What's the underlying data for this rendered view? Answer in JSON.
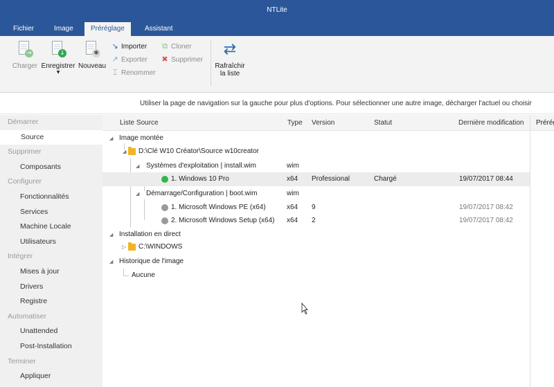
{
  "window": {
    "title": "NTLite"
  },
  "tabs": [
    {
      "label": "Fichier"
    },
    {
      "label": "Image"
    },
    {
      "label": "Préréglage",
      "active": true
    },
    {
      "label": "Assistant"
    }
  ],
  "ribbon": {
    "large_buttons": [
      {
        "label": "Charger",
        "icon": "load-preset-icon",
        "enabled": false
      },
      {
        "label": "Enregistrer",
        "icon": "save-preset-icon",
        "enabled": true,
        "dropdown": true
      },
      {
        "label": "Nouveau",
        "icon": "new-preset-icon",
        "enabled": true
      }
    ],
    "small_buttons": [
      {
        "label": "Importer",
        "icon": "import-icon",
        "enabled": true
      },
      {
        "label": "Exporter",
        "icon": "export-icon",
        "enabled": false
      },
      {
        "label": "Renommer",
        "icon": "rename-icon",
        "enabled": false
      },
      {
        "label": "Cloner",
        "icon": "clone-icon",
        "enabled": false
      },
      {
        "label": "Supprimer",
        "icon": "delete-icon",
        "enabled": false
      }
    ],
    "refresh": {
      "line1": "Rafraîchir",
      "line2": "la liste",
      "icon": "refresh-icon"
    }
  },
  "info_text": "Utiliser la page de navigation sur la gauche pour plus d'options. Pour sélectionner une autre image, décharger l'actuel ou choisir",
  "nav": {
    "sections": [
      {
        "label": "Démarrer",
        "items": [
          "Source"
        ]
      },
      {
        "label": "Supprimer",
        "items": [
          "Composants"
        ]
      },
      {
        "label": "Configurer",
        "items": [
          "Fonctionnalités",
          "Services",
          "Machine Locale",
          "Utilisateurs"
        ]
      },
      {
        "label": "Intégrer",
        "items": [
          "Mises à jour",
          "Drivers",
          "Registre"
        ]
      },
      {
        "label": "Automatiser",
        "items": [
          "Unattended",
          "Post-Installation"
        ]
      },
      {
        "label": "Terminer",
        "items": [
          "Appliquer"
        ]
      }
    ],
    "selected": "Source"
  },
  "table": {
    "columns": [
      "Liste Source",
      "Type",
      "Version",
      "Statut",
      "Dernière modification"
    ],
    "rows": [
      {
        "name": "Image montée",
        "type": "",
        "version": "",
        "status": "",
        "modified": ""
      },
      {
        "name": "D:\\Clé W10 Créator\\Source w10creator",
        "type": "",
        "version": "",
        "status": "",
        "modified": ""
      },
      {
        "name": "Systèmes d'exploitation  |  install.wim",
        "type": "wim",
        "version": "",
        "status": "",
        "modified": ""
      },
      {
        "name": "1. Windows 10 Pro",
        "type": "x64",
        "version": "Professional",
        "status": "Chargé",
        "modified": "19/07/2017 08:44",
        "state_color": "#2fb84a"
      },
      {
        "name": "Démarrage/Configuration  |  boot.wim",
        "type": "wim",
        "version": "",
        "status": "",
        "modified": ""
      },
      {
        "name": "1. Microsoft Windows PE (x64)",
        "type": "x64",
        "version": "9",
        "status": "",
        "modified": "19/07/2017 08:42",
        "state_color": "#9a9a9a"
      },
      {
        "name": "2. Microsoft Windows Setup (x64)",
        "type": "x64",
        "version": "2",
        "status": "",
        "modified": "19/07/2017 08:42",
        "state_color": "#9a9a9a"
      },
      {
        "name": "Installation en direct",
        "type": "",
        "version": "",
        "status": "",
        "modified": ""
      },
      {
        "name": "C:\\WINDOWS",
        "type": "",
        "version": "",
        "status": "",
        "modified": ""
      },
      {
        "name": "Historique de l'image",
        "type": "",
        "version": "",
        "status": "",
        "modified": ""
      },
      {
        "name": "Aucune",
        "type": "",
        "version": "",
        "status": "",
        "modified": ""
      }
    ]
  },
  "right_panel": {
    "header": "Prérég"
  },
  "colors": {
    "accent": "#2b579a",
    "nav_bg": "#f0f0f0",
    "selected_row": "#ececec"
  }
}
